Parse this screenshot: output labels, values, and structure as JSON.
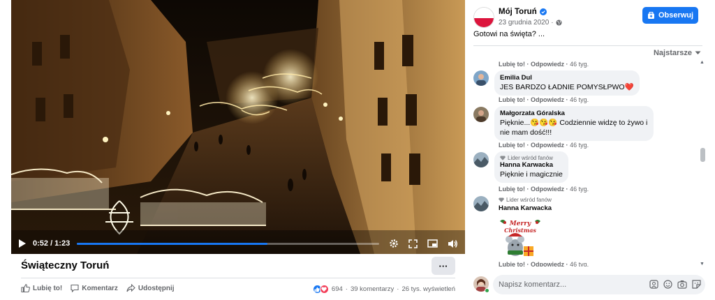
{
  "video": {
    "time": "0:52 / 1:23",
    "progress": 0.63
  },
  "post": {
    "title": "Świąteczny Toruń",
    "more": "···",
    "actions": {
      "like": "Lubię to!",
      "comment": "Komentarz",
      "share": "Udostępnij"
    },
    "stats": {
      "reactions": "694",
      "comments": "39 komentarzy",
      "views": "26 tys. wyświetleń"
    }
  },
  "page": {
    "name": "Mój Toruń",
    "date": "23 grudnia 2020",
    "follow": "Obserwuj",
    "caption": "Gotowi na święta? ..."
  },
  "sort_label": "Najstarsze",
  "comment_meta": {
    "like": "Lubię to!",
    "reply": "Odpowiedz",
    "sep": "·",
    "dur": "46 tyg."
  },
  "comments": [
    {
      "author": "Emilia Dul",
      "text": "JES BARDZO ŁADNIE POMYSŁPWO❤️"
    },
    {
      "author": "Małgorzata Góralska",
      "text": "Pięknie...😘😘😘 Codziennie widzę to żywo i nie mam dość!!!"
    },
    {
      "author": "Hanna Karwacka",
      "badge": "Lider wśród fanów",
      "text": "Pięknie i magicznie"
    },
    {
      "author": "Hanna Karwacka",
      "badge": "Lider wśród fanów",
      "sticker_text": "Merry Christmas"
    }
  ],
  "composer": {
    "placeholder": "Napisz komentarz..."
  },
  "colors": {
    "accent": "#1877f2",
    "bubble": "#f0f2f5",
    "muted": "#65676b"
  }
}
